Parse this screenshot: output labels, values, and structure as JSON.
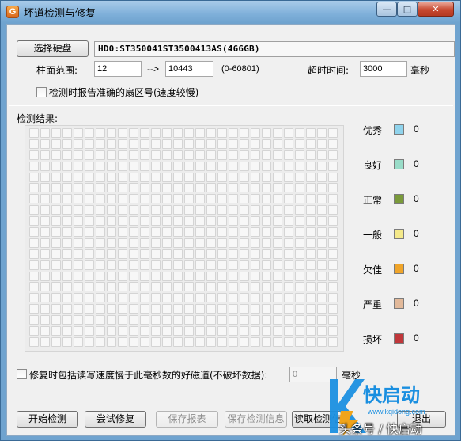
{
  "window": {
    "title": "坏道检测与修复",
    "app_icon_letter": "G",
    "controls": {
      "minimize": "—",
      "maximize": "□",
      "close": "✕"
    }
  },
  "disk": {
    "select_button": "选择硬盘",
    "selected": "HD0:ST350041ST3500413AS(466GB)"
  },
  "range": {
    "label": "柱面范围:",
    "start": "12",
    "arrow": "-->",
    "end": "10443",
    "hint": "(0-60801)"
  },
  "timeout": {
    "label": "超时时间:",
    "value": "3000",
    "unit": "毫秒"
  },
  "options": {
    "report_sector": "检测时报告准确的扇区号(速度较慢)",
    "repair_slow": "修复时包括读写速度慢于此毫秒数的好磁道(不破坏数据):",
    "repair_value": "0",
    "repair_unit": "毫秒"
  },
  "results": {
    "label": "检测结果:"
  },
  "legend": [
    {
      "label": "优秀",
      "color": "#8fd3ec",
      "count": "0"
    },
    {
      "label": "良好",
      "color": "#99dcc8",
      "count": "0"
    },
    {
      "label": "正常",
      "color": "#7a9a3a",
      "count": "0"
    },
    {
      "label": "一般",
      "color": "#f4e98a",
      "count": "0"
    },
    {
      "label": "欠佳",
      "color": "#f0a52a",
      "count": "0"
    },
    {
      "label": "严重",
      "color": "#e2b99a",
      "count": "0"
    },
    {
      "label": "损坏",
      "color": "#c0373a",
      "count": "0"
    }
  ],
  "buttons": {
    "start": "开始检测",
    "repair": "尝试修复",
    "save_report": "保存报表",
    "save_info": "保存检测信息",
    "read_info": "读取检测信息",
    "exit": "退出"
  },
  "watermark": {
    "brand": "快启动",
    "url": "www.kqidong.com",
    "caption": "头条号 / 快启动"
  }
}
